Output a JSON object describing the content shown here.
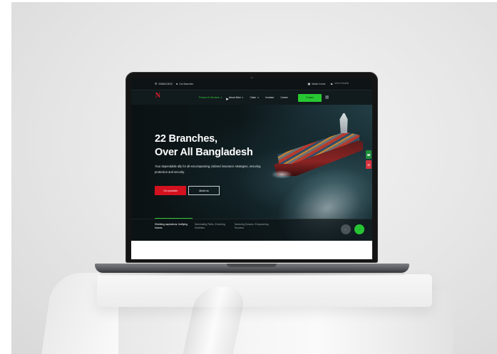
{
  "topbar": {
    "phone": "09666215030",
    "branches_link": "Our Branches",
    "media_corner": "Media Corner",
    "language": "বাংলা / ইংরেজি"
  },
  "nav": {
    "logo_letter": "N",
    "items": [
      {
        "label": "Product & Services",
        "has_caret": true,
        "active": true
      },
      {
        "label": "About Nitol",
        "has_caret": true,
        "active": false
      },
      {
        "label": "Claim",
        "has_caret": true,
        "active": false
      },
      {
        "label": "Investor",
        "has_caret": false,
        "active": false
      },
      {
        "label": "Career",
        "has_caret": false,
        "active": false
      }
    ],
    "contact_label": "Contact"
  },
  "hero": {
    "title_line1": "22 Branches,",
    "title_line2": "Over All Bangladesh",
    "description": "Your dependable ally for all-encompassing, tailored insurance strategies, ensuring protection and security.",
    "primary_button": "Our products",
    "secondary_button": "About us",
    "taglines": [
      "Shielding aspirations, fortifying futures.",
      "Illuminating Paths, Enriching Destinies.",
      "Nurturing Dreams, Empowering Success."
    ]
  },
  "icons": {
    "phone": "phone-icon",
    "location": "location-pin-icon",
    "media": "media-icon",
    "language": "globe-icon",
    "menu_grid": "grid-menu-icon",
    "cursor": "mouse-cursor-icon",
    "prev": "arrow-left-icon",
    "next": "arrow-right-icon"
  },
  "colors": {
    "accent_green": "#28c832",
    "brand_red": "#d4111f",
    "hero_bg": "#0b1316"
  }
}
